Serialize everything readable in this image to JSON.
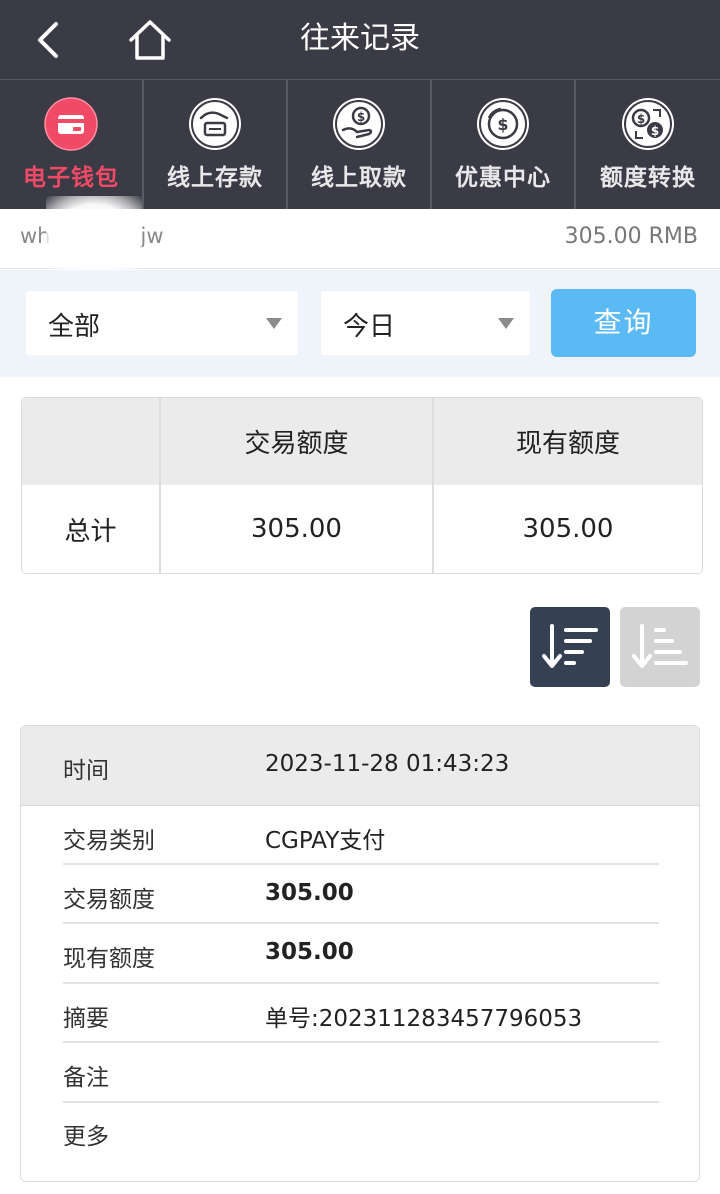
{
  "header": {
    "title": "往来记录"
  },
  "nav": {
    "tabs": [
      {
        "label": "电子钱包",
        "icon": "wallet-icon",
        "active": true
      },
      {
        "label": "线上存款",
        "icon": "deposit-icon",
        "active": false
      },
      {
        "label": "线上取款",
        "icon": "withdraw-icon",
        "active": false
      },
      {
        "label": "优惠中心",
        "icon": "promo-icon",
        "active": false
      },
      {
        "label": "额度转换",
        "icon": "transfer-icon",
        "active": false
      }
    ]
  },
  "account": {
    "username_visible": "wh",
    "username_suffix": "jw",
    "balance": "305.00 RMB"
  },
  "filter": {
    "type_value": "全部",
    "date_value": "今日",
    "query_label": "查询"
  },
  "summary": {
    "headers": [
      "",
      "交易额度",
      "现有额度"
    ],
    "row_label": "总计",
    "transaction_amount": "305.00",
    "current_amount": "305.00"
  },
  "record": {
    "time_label": "时间",
    "time_value": "2023-11-28 01:43:23",
    "type_label": "交易类别",
    "type_value": "CGPAY支付",
    "amount_label": "交易额度",
    "amount_value": "305.00",
    "balance_label": "现有额度",
    "balance_value": "305.00",
    "summary_label": "摘要",
    "summary_value": "单号:202311283457796053",
    "note_label": "备注",
    "more_label": "更多"
  },
  "colors": {
    "header_bg": "#3a3b45",
    "active_tab": "#f04a67",
    "query_button": "#5bb9f3",
    "sort_active": "#354153",
    "sort_inactive": "#d3d3d3"
  }
}
